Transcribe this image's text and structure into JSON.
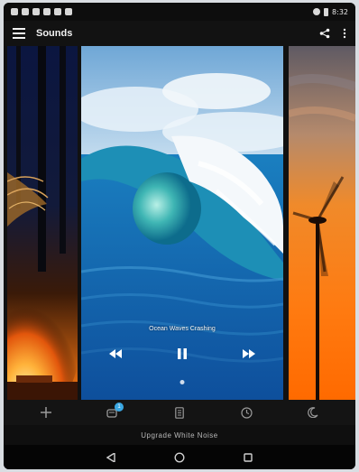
{
  "toolbar": {
    "title": "Sounds"
  },
  "status": {
    "time": "8:32"
  },
  "cards": [
    {
      "name": "Campfire",
      "active": false
    },
    {
      "name": "Ocean Waves Crashing",
      "active": true
    },
    {
      "name": "Wind Turbine",
      "active": false
    }
  ],
  "player": {
    "now_playing": "Ocean Waves Crashing"
  },
  "tabs": {
    "add_icon": "plus-icon",
    "mix_icon": "mix-icon",
    "mix_badge": "1",
    "timer_icon": "timer-icon",
    "alarm_icon": "alarm-icon",
    "sleep_icon": "moon-icon"
  },
  "upgrade": {
    "label": "Upgrade White Noise"
  },
  "colors": {
    "accent": "#3aa7e2",
    "background": "#0a0a0a",
    "toolbar": "#121212"
  }
}
